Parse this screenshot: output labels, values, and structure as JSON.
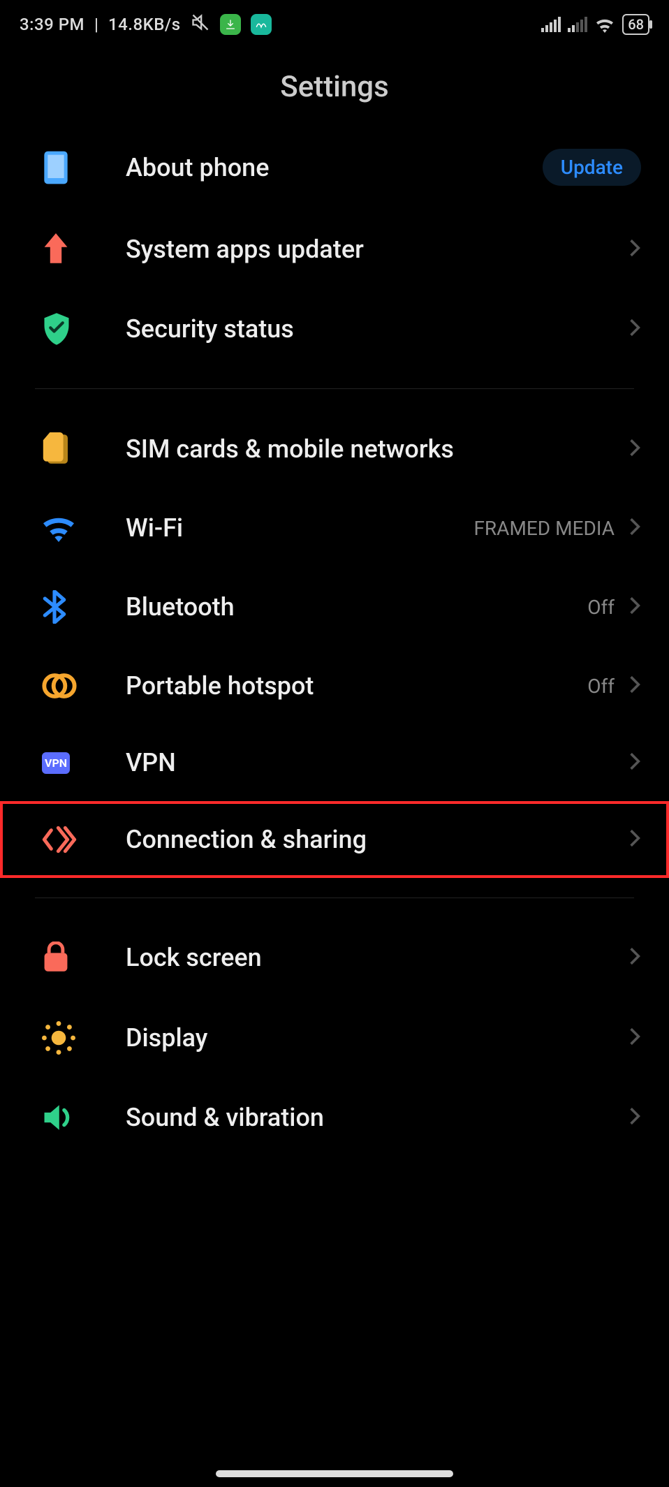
{
  "status_bar": {
    "time": "3:39 PM",
    "net_speed": "14.8KB/s",
    "battery": "68"
  },
  "title": "Settings",
  "groups": [
    {
      "items": [
        {
          "id": "about-phone",
          "label": "About phone",
          "icon": "phone-icon",
          "badge": "Update",
          "chevron": false
        },
        {
          "id": "sys-updater",
          "label": "System apps updater",
          "icon": "arrow-up-icon",
          "chevron": true
        },
        {
          "id": "security",
          "label": "Security status",
          "icon": "shield-icon",
          "chevron": true
        }
      ]
    },
    {
      "items": [
        {
          "id": "sim",
          "label": "SIM cards & mobile networks",
          "icon": "sim-icon",
          "chevron": true
        },
        {
          "id": "wifi",
          "label": "Wi-Fi",
          "icon": "wifi-icon",
          "value": "FRAMED MEDIA",
          "chevron": true
        },
        {
          "id": "bluetooth",
          "label": "Bluetooth",
          "icon": "bluetooth-icon",
          "value": "Off",
          "chevron": true
        },
        {
          "id": "hotspot",
          "label": "Portable hotspot",
          "icon": "hotspot-icon",
          "value": "Off",
          "chevron": true
        },
        {
          "id": "vpn",
          "label": "VPN",
          "icon": "vpn-icon",
          "vpn_text": "VPN",
          "chevron": true
        },
        {
          "id": "connection",
          "label": "Connection & sharing",
          "icon": "connection-icon",
          "chevron": true,
          "highlight": true
        }
      ]
    },
    {
      "items": [
        {
          "id": "lockscreen",
          "label": "Lock screen",
          "icon": "lock-icon",
          "chevron": true
        },
        {
          "id": "display",
          "label": "Display",
          "icon": "sun-icon",
          "chevron": true
        },
        {
          "id": "sound",
          "label": "Sound & vibration",
          "icon": "speaker-icon",
          "chevron": true
        }
      ]
    }
  ]
}
